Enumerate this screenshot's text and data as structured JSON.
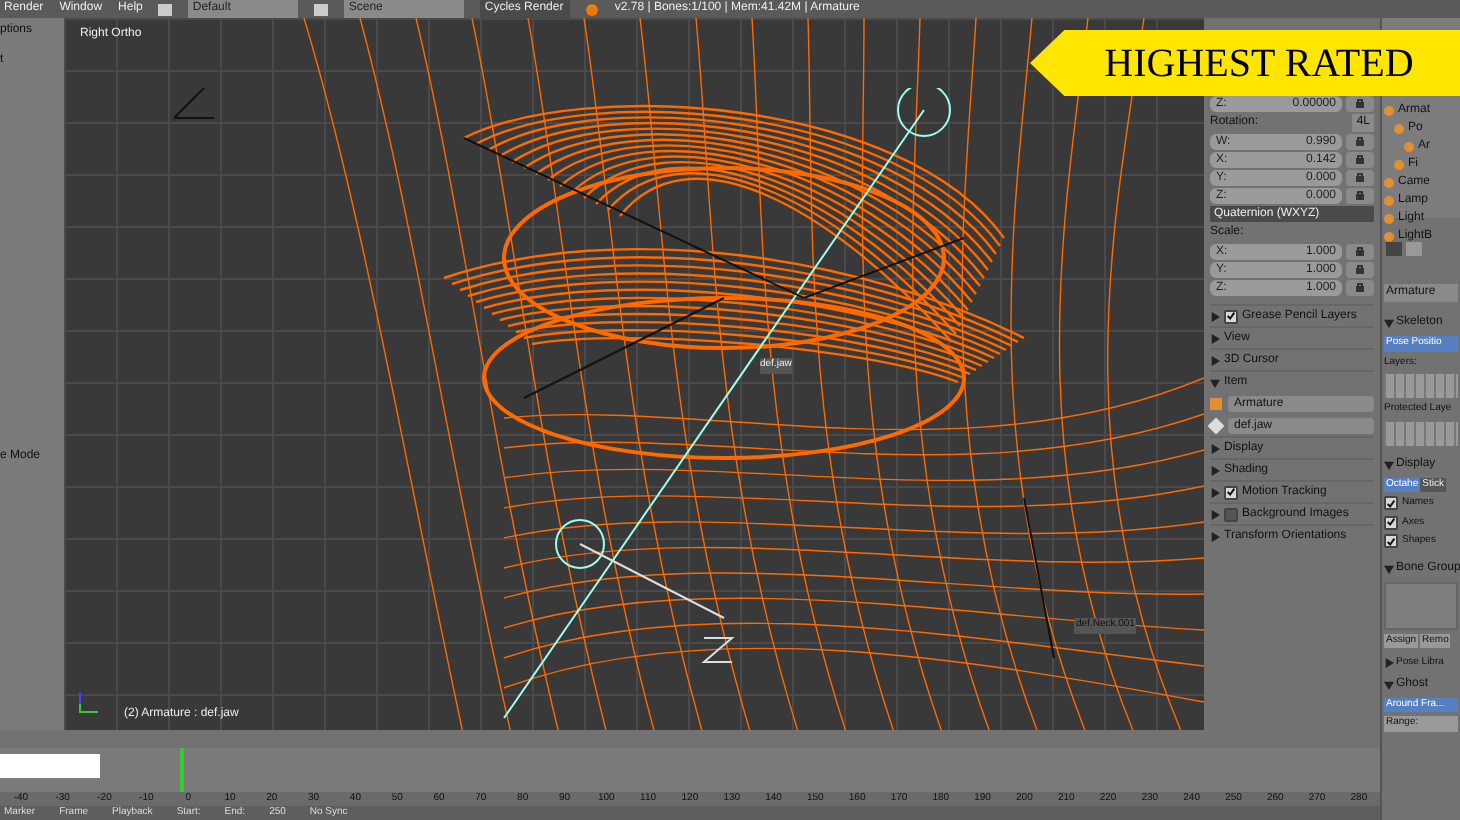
{
  "top_bar": {
    "menus": [
      "Render",
      "Window",
      "Help"
    ],
    "screen_layout": "Default",
    "scene": "Scene",
    "render_engine": "Cycles Render",
    "stats": "v2.78 | Bones:1/100 | Mem:41.42M | Armature"
  },
  "badge": "HIGHEST RATED",
  "tool_shelf": {
    "texts": [
      "ptions",
      "t",
      "e Mode"
    ]
  },
  "viewport": {
    "view_name": "Right Ortho",
    "bone_labels": [
      "def.jaw",
      "def.Neck.001"
    ],
    "status": "(2) Armature : def.jaw"
  },
  "n_panel": {
    "location_z": {
      "label": "Z:",
      "value": "0.00000"
    },
    "rotation_label": "Rotation:",
    "rotation_lock": "4L",
    "rotation": [
      {
        "label": "W:",
        "value": "0.990"
      },
      {
        "label": "X:",
        "value": "0.142"
      },
      {
        "label": "Y:",
        "value": "0.000"
      },
      {
        "label": "Z:",
        "value": "0.000"
      }
    ],
    "rotation_mode": "Quaternion (WXYZ)",
    "scale_label": "Scale:",
    "scale": [
      {
        "label": "X:",
        "value": "1.000"
      },
      {
        "label": "Y:",
        "value": "1.000"
      },
      {
        "label": "Z:",
        "value": "1.000"
      }
    ],
    "sections": [
      {
        "title": "Grease Pencil Layers",
        "expanded": false,
        "kind": "check",
        "checked": true
      },
      {
        "title": "View",
        "expanded": false,
        "kind": "plain"
      },
      {
        "title": "3D Cursor",
        "expanded": false,
        "kind": "plain"
      },
      {
        "title": "Item",
        "expanded": true,
        "kind": "plain",
        "fields": [
          "Armature",
          "def.jaw"
        ]
      },
      {
        "title": "Display",
        "expanded": false,
        "kind": "plain"
      },
      {
        "title": "Shading",
        "expanded": false,
        "kind": "plain"
      },
      {
        "title": "Motion Tracking",
        "expanded": false,
        "kind": "check",
        "checked": true
      },
      {
        "title": "Background Images",
        "expanded": false,
        "kind": "check",
        "checked": false
      },
      {
        "title": "Transform Orientations",
        "expanded": false,
        "kind": "plain"
      }
    ]
  },
  "outliner": {
    "items": [
      {
        "label": "Armat",
        "children": [
          {
            "label": "Po",
            "children": [
              {
                "label": "Ar"
              }
            ]
          },
          {
            "label": "Fi"
          }
        ]
      },
      {
        "label": "Came"
      },
      {
        "label": "Lamp"
      },
      {
        "label": "Light"
      },
      {
        "label": "LightB"
      }
    ]
  },
  "properties": {
    "object_name": "Armature",
    "skeleton": {
      "title": "Skeleton",
      "expanded": true,
      "pose_button": "Pose Positio",
      "layers_label": "Layers:",
      "protected_label": "Protected Laye"
    },
    "display": {
      "title": "Display",
      "expanded": true,
      "draw_types": [
        {
          "label": "Octahe",
          "selected": true
        },
        {
          "label": "Stick",
          "selected": false
        }
      ],
      "options": [
        {
          "label": "Names",
          "checked": true
        },
        {
          "label": "Axes",
          "checked": true
        },
        {
          "label": "Shapes",
          "checked": true
        }
      ]
    },
    "bone_groups": {
      "title": "Bone Group",
      "expanded": true,
      "buttons": [
        "Assign",
        "Remo"
      ]
    },
    "pose_library": {
      "title": "Pose Libra",
      "expanded": false
    },
    "ghost": {
      "title": "Ghost",
      "expanded": true,
      "modes": [
        {
          "label": "Around Fra...",
          "selected": true
        }
      ],
      "range_label": "Range:"
    }
  },
  "timeline": {
    "playhead": {
      "level": 0.13
    },
    "ruler": [
      "-40",
      "-30",
      "-20",
      "-10",
      "0",
      "10",
      "20",
      "30",
      "40",
      "50",
      "60",
      "70",
      "80",
      "90",
      "100",
      "110",
      "120",
      "130",
      "140",
      "150",
      "160",
      "170",
      "180",
      "190",
      "200",
      "210",
      "220",
      "230",
      "240",
      "250",
      "260",
      "270",
      "280"
    ],
    "footer": [
      "Marker",
      "Frame",
      "Playback",
      "Start:",
      "End:",
      "250",
      "No Sync"
    ]
  }
}
